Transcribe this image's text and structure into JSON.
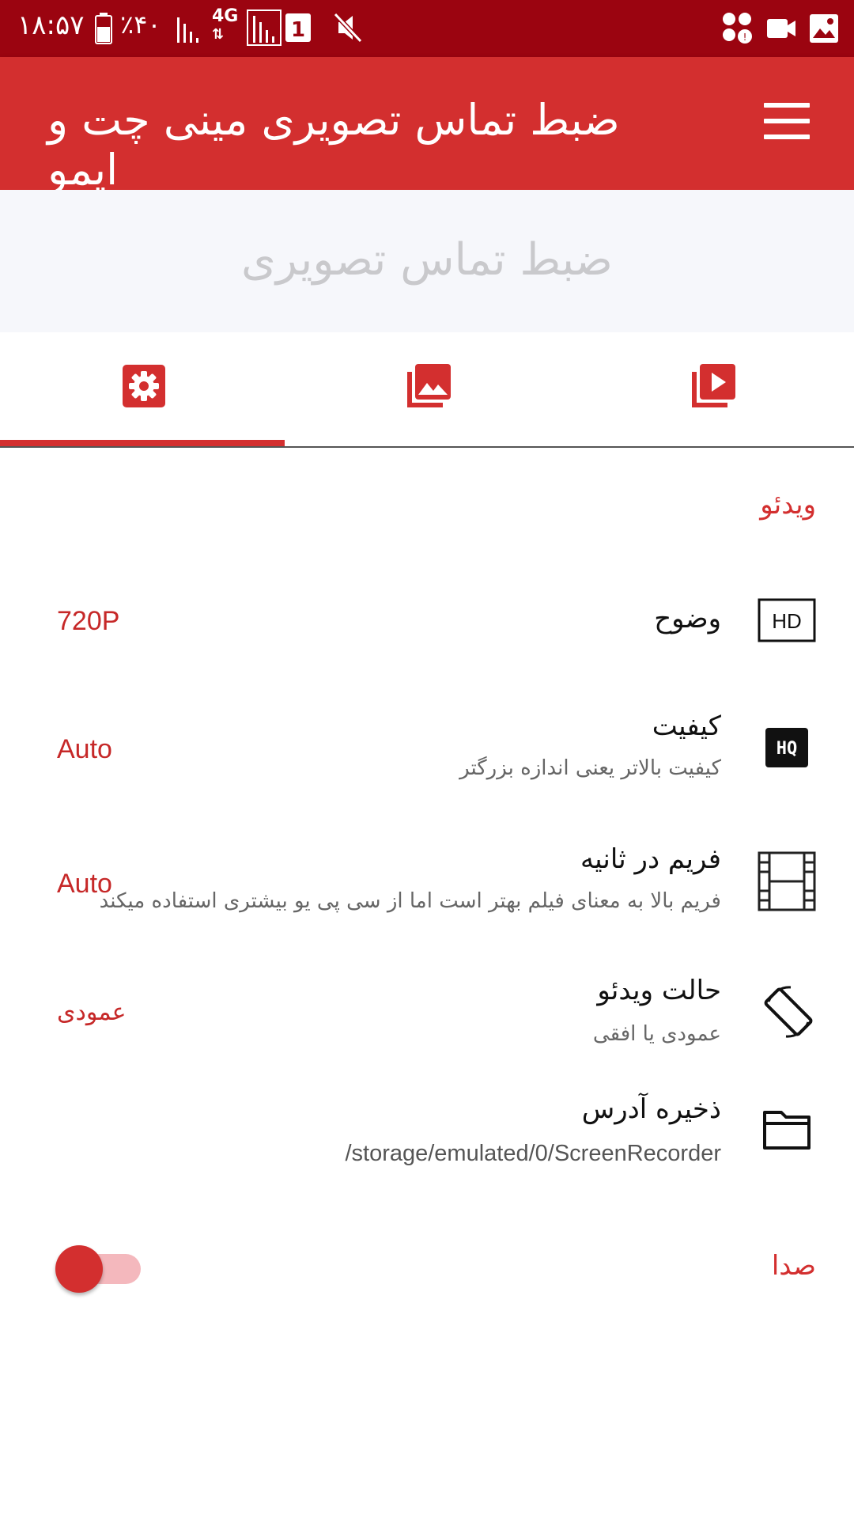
{
  "status_bar": {
    "time": "۱۸:۵۷",
    "battery": "٪۴۰",
    "network": "4G",
    "sim": "1"
  },
  "app_bar": {
    "title": "ضبط تماس تصویری مینی چت و ایمو"
  },
  "banner": {
    "text": "ضبط تماس تصویری"
  },
  "tabs": [
    {
      "icon": "gear-icon",
      "selected": true
    },
    {
      "icon": "photo-library-icon",
      "selected": false
    },
    {
      "icon": "video-library-icon",
      "selected": false
    }
  ],
  "settings": {
    "section_title": "ویدئو",
    "resolution": {
      "icon": "hd-icon",
      "title": "وضوح",
      "value": "720P"
    },
    "quality": {
      "icon": "hq-icon",
      "title": "کیفیت",
      "subtitle": "کیفیت بالاتر یعنی اندازه بزرگتر",
      "value": "Auto"
    },
    "fps": {
      "icon": "film-strip-icon",
      "title": "فریم در ثانیه",
      "subtitle": "فریم بالا به معنای فیلم بهتر است اما از سی پی یو بیشتری استفاده میکند",
      "value": "Auto"
    },
    "orientation": {
      "icon": "screen-rotation-icon",
      "title": "حالت ویدئو",
      "subtitle": "عمودی یا افقی",
      "value": "عمودی"
    },
    "save_path": {
      "icon": "folder-icon",
      "title": "ذخیره آدرس",
      "subtitle": "/storage/emulated/0/ScreenRecorder"
    },
    "sound": {
      "label": "صدا",
      "enabled": false
    }
  },
  "colors": {
    "status_bar": "#9b0410",
    "app_bar": "#d32f2f",
    "accent": "#d32f2f"
  }
}
